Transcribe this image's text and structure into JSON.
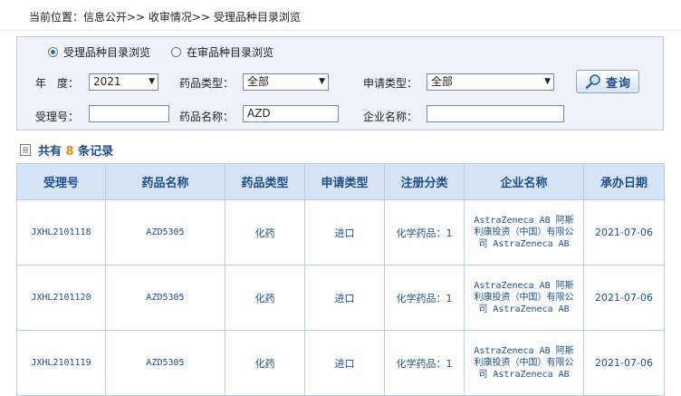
{
  "breadcrumb": "当前位置：信息公开>> 收审情况>> 受理品种目录浏览",
  "filters": {
    "radio_accepted": "受理品种目录浏览",
    "radio_review": "在审品种目录浏览",
    "year_label": "年　度：",
    "year_value": "2021",
    "drug_type_label": "药品类型：",
    "drug_type_value": "全部",
    "apply_type_label": "申请类型：",
    "apply_type_value": "全部",
    "accept_no_label": "受理号：",
    "accept_no_value": "",
    "drug_name_label": "药品名称：",
    "drug_name_value": "AZD",
    "company_label": "企业名称：",
    "company_value": "",
    "search_button": "查询"
  },
  "summary": {
    "prefix": "共有",
    "count": "8",
    "suffix": "条记录"
  },
  "table": {
    "headers": [
      "受理号",
      "药品名称",
      "药品类型",
      "申请类型",
      "注册分类",
      "企业名称",
      "承办日期"
    ],
    "rows": [
      [
        "JXHL2101118",
        "AZD5305",
        "化药",
        "进口",
        "化学药品：1",
        "AstraZeneca AB 阿斯利康投资（中国）有限公司 AstraZeneca AB",
        "2021-07-06"
      ],
      [
        "JXHL2101120",
        "AZD5305",
        "化药",
        "进口",
        "化学药品：1",
        "AstraZeneca AB 阿斯利康投资（中国）有限公司 AstraZeneca AB",
        "2021-07-06"
      ],
      [
        "JXHL2101119",
        "AZD5305",
        "化药",
        "进口",
        "化学药品：1",
        "AstraZeneca AB 阿斯利康投资（中国）有限公司 AstraZeneca AB",
        "2021-07-06"
      ]
    ]
  }
}
